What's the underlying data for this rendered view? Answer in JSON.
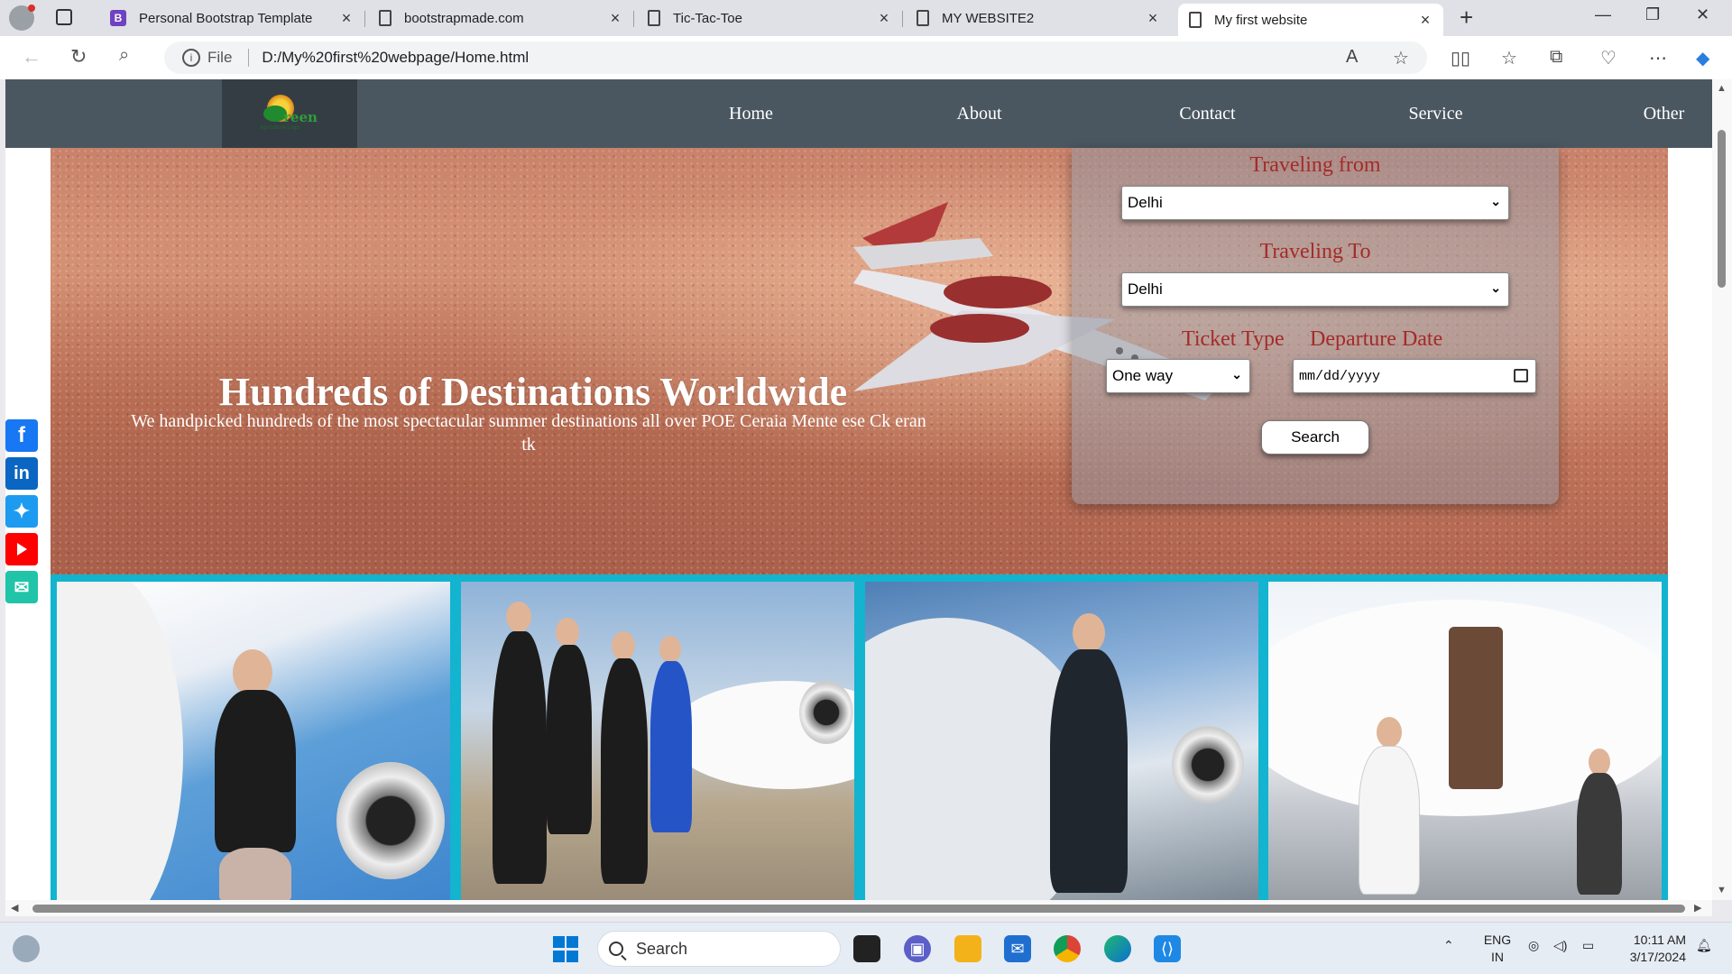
{
  "browser": {
    "tabs": [
      {
        "title": "Personal Bootstrap Template",
        "icon": "bootstrap-icon"
      },
      {
        "title": "bootstrapmade.com",
        "icon": "shield-doc-icon"
      },
      {
        "title": "Tic-Tac-Toe",
        "icon": "document-icon"
      },
      {
        "title": "MY WEBSITE2",
        "icon": "document-icon"
      },
      {
        "title": "My first website",
        "icon": "document-icon",
        "active": true
      }
    ],
    "address": {
      "scheme_label": "File",
      "url": "D:/My%20first%20webpage/Home.html"
    }
  },
  "site": {
    "logo_text": "reen",
    "logo_subtext": "Agriculture Logo",
    "nav": [
      "Home",
      "About",
      "Contact",
      "Service",
      "Other"
    ],
    "hero": {
      "title": "Hundreds of Destinations Worldwide",
      "subtitle": "We handpicked hundreds of the most spectacular summer destinations all over POE Ceraia Mente ese Ck eran tk"
    },
    "booking": {
      "from_label": "Traveling from",
      "from_value": "Delhi",
      "to_label": "Traveling To",
      "to_value": "Delhi",
      "ticket_label": "Ticket Type",
      "ticket_value": "One way",
      "departure_label": "Departure Date",
      "departure_placeholder": "mm/dd/yyyy",
      "search_label": "Search"
    },
    "social": [
      "facebook",
      "linkedin",
      "twitter",
      "youtube",
      "mail"
    ],
    "colors": {
      "navbar": "#4b5760",
      "gallery_border": "#12b4cf",
      "booking_label": "#a52a2a"
    }
  },
  "taskbar": {
    "search_placeholder": "Search",
    "lang": "ENG",
    "region": "IN",
    "time": "10:11 AM",
    "date": "3/17/2024"
  }
}
